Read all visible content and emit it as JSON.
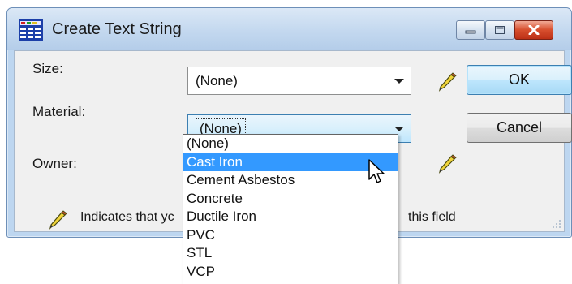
{
  "window": {
    "title": "Create Text String",
    "icon": "app-grid-icon",
    "controls": {
      "minimize_icon": "minimize-icon",
      "maximize_icon": "maximize-icon",
      "close_icon": "close-icon"
    }
  },
  "form": {
    "size": {
      "label": "Size:",
      "value": "(None)"
    },
    "material": {
      "label": "Material:",
      "value": "(None)"
    },
    "owner": {
      "label": "Owner:"
    }
  },
  "buttons": {
    "ok": "OK",
    "cancel": "Cancel"
  },
  "note": {
    "text_start": "Indicates that yc",
    "text_end": "this field",
    "icon": "pencil-icon"
  },
  "material_dropdown": {
    "options": [
      "(None)",
      "Cast Iron",
      "Cement Asbestos",
      "Concrete",
      "Ductile Iron",
      "PVC",
      "STL",
      "VCP"
    ],
    "highlighted": "Cast Iron"
  },
  "colors": {
    "selection": "#3399ff",
    "title_bar": "#c3d8ef",
    "close_button": "#d8502f"
  }
}
